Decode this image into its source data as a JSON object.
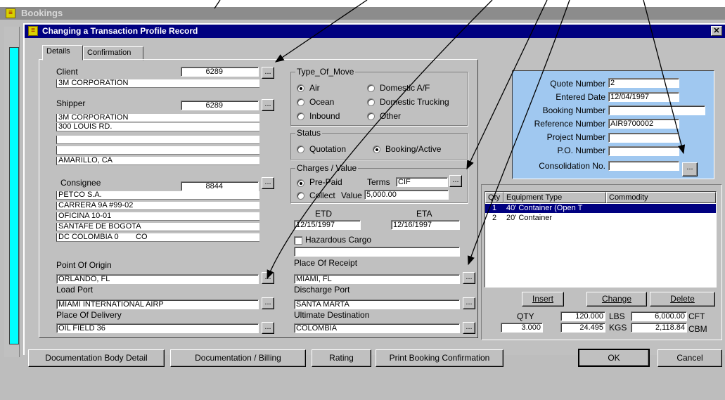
{
  "outer_window": {
    "title": "Bookings"
  },
  "dialog": {
    "title": "Changing a Transaction Profile Record",
    "close_glyph": "✕",
    "tabs": [
      {
        "label": "Details"
      },
      {
        "label": "Confirmation"
      }
    ]
  },
  "client": {
    "label": "Client",
    "code": "6289",
    "name": "3M CORPORATION"
  },
  "shipper": {
    "label": "Shipper",
    "code": "6289",
    "lines": [
      "3M CORPORATION",
      "300 LOUIS RD.",
      "",
      "",
      "AMARILLO, CA"
    ]
  },
  "consignee": {
    "label": "Consignee",
    "code": "8844",
    "lines": [
      "PETCO S.A.",
      "CARRERA 9A #99-02",
      "OFICINA 10-01",
      "SANTAFE DE BOGOTA",
      "DC COLOMBIA 0        CO"
    ]
  },
  "type_of_move": {
    "title": "Type_Of_Move",
    "options": [
      "Air",
      "Domestic A/F",
      "Ocean",
      "Domestic Trucking",
      "Inbound",
      "Other"
    ],
    "selected": "Air"
  },
  "status": {
    "title": "Status",
    "options": [
      "Quotation",
      "Booking/Active"
    ],
    "selected": "Booking/Active"
  },
  "charges": {
    "title": "Charges / Value",
    "options": [
      "Pre-Paid",
      "Collect"
    ],
    "selected": "Pre-Paid",
    "terms_label": "Terms",
    "terms_value": "CIF",
    "value_label": "Value",
    "value": "5,000.00"
  },
  "dates": {
    "etd_label": "ETD",
    "etd": "12/15/1997",
    "eta_label": "ETA",
    "eta": "12/16/1997"
  },
  "hazardous": {
    "label": "Hazardous Cargo",
    "checked": false,
    "value": ""
  },
  "route": {
    "point_of_origin": {
      "label": "Point Of Origin",
      "value": "ORLANDO, FL"
    },
    "load_port": {
      "label": "Load Port",
      "value": "MIAMI INTERNATIONAL AIRP"
    },
    "place_of_delivery": {
      "label": "Place Of Delivery",
      "value": "OIL FIELD 36"
    },
    "place_of_receipt": {
      "label": "Place Of Receipt",
      "value": "MIAMI, FL"
    },
    "discharge_port": {
      "label": "Discharge Port",
      "value": "SANTA MARTA"
    },
    "ultimate_destination": {
      "label": "Ultimate Destination",
      "value": "COLOMBIA"
    }
  },
  "quote": {
    "quote_number_label": "Quote Number",
    "quote_number": "2",
    "entered_date_label": "Entered Date",
    "entered_date": "12/04/1997",
    "booking_number_label": "Booking Number",
    "booking_number": "",
    "reference_number_label": "Reference Number",
    "reference_number": "AIR9700002",
    "project_number_label": "Project Number",
    "project_number": "",
    "po_number_label": "P.O. Number",
    "po_number": "",
    "consolidation_label": "Consolidation No.",
    "consolidation": ""
  },
  "equipment": {
    "columns": [
      "Qty",
      "Equipment Type",
      "Commodity"
    ],
    "rows": [
      {
        "qty": "1",
        "type": "40' Container (Open T",
        "commodity": ""
      },
      {
        "qty": "2",
        "type": "20' Container",
        "commodity": ""
      }
    ],
    "insert_label": "Insert",
    "change_label": "Change",
    "delete_label": "Delete",
    "qty_label": "QTY",
    "qty": "3.000",
    "lbs_value": "120.000",
    "lbs_label": "LBS",
    "kgs_value": "24.495",
    "kgs_label": "KGS",
    "cft_value": "6,000.00",
    "cft_label": "CFT",
    "cbm_value": "2,118.84",
    "cbm_label": "CBM"
  },
  "buttons": {
    "doc_body": "Documentation Body Detail",
    "doc_billing": "Documentation / Billing",
    "rating": "Rating",
    "print": "Print Booking Confirmation",
    "ok": "OK",
    "cancel": "Cancel",
    "ellipsis": "..."
  },
  "colors": {
    "title_bar": "#000080",
    "highlight_box": "#a0c8f0",
    "outer_cyan": "#00ffff"
  }
}
